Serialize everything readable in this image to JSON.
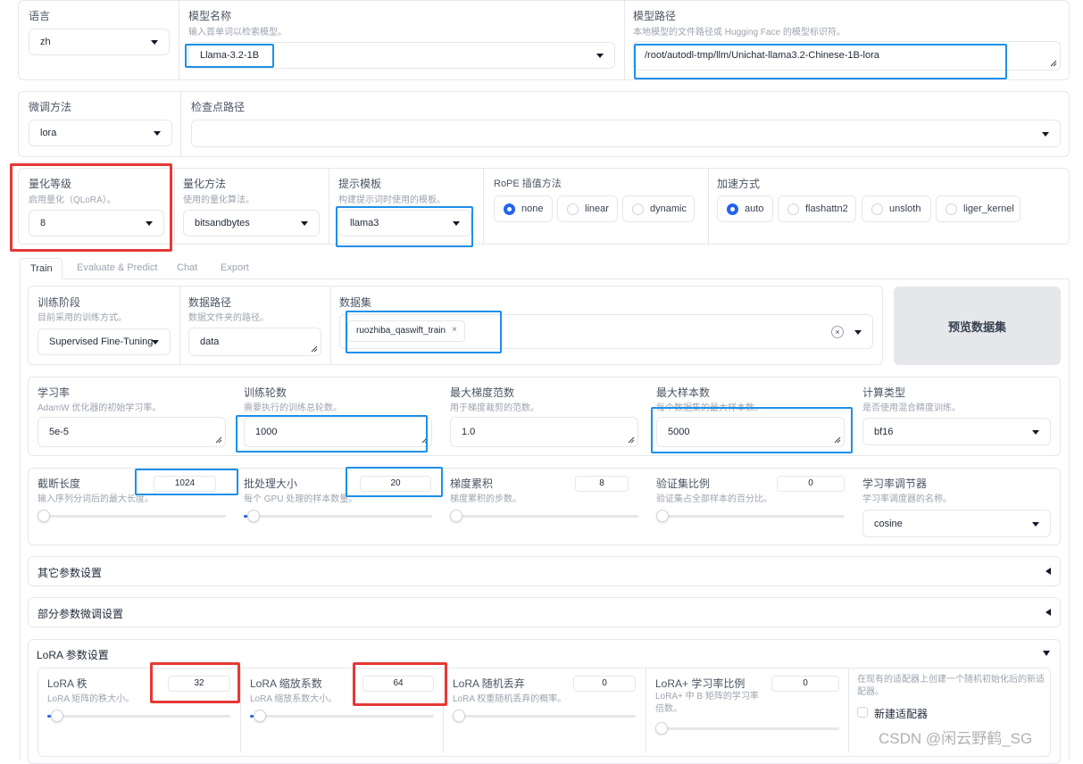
{
  "top": {
    "language": {
      "label": "语言",
      "value": "zh"
    },
    "model_name": {
      "label": "模型名称",
      "sub": "输入首单词以检索模型。",
      "value": "Llama-3.2-1B"
    },
    "model_path": {
      "label": "模型路径",
      "sub": "本地模型的文件路径或 Hugging Face 的模型标识符。",
      "value": "/root/autodl-tmp/llm/Unichat-llama3.2-Chinese-1B-lora"
    }
  },
  "row2": {
    "finetune": {
      "label": "微调方法",
      "value": "lora"
    },
    "checkpoint": {
      "label": "检查点路径",
      "value": ""
    }
  },
  "row3": {
    "quant_level": {
      "label": "量化等级",
      "sub": "启用量化（QLoRA）。",
      "value": "8"
    },
    "quant_method": {
      "label": "量化方法",
      "sub": "使用的量化算法。",
      "value": "bitsandbytes"
    },
    "template": {
      "label": "提示模板",
      "sub": "构建提示词时使用的模板。",
      "value": "llama3"
    },
    "rope": {
      "label": "RoPE 插值方法",
      "options": [
        "none",
        "linear",
        "dynamic"
      ],
      "selected": "none"
    },
    "boost": {
      "label": "加速方式",
      "options": [
        "auto",
        "flashattn2",
        "unsloth",
        "liger_kernel"
      ],
      "selected": "auto"
    }
  },
  "tabs": [
    "Train",
    "Evaluate & Predict",
    "Chat",
    "Export"
  ],
  "train": {
    "stage": {
      "label": "训练阶段",
      "sub": "目前采用的训练方式。",
      "value": "Supervised Fine-Tuning"
    },
    "dataset_dir": {
      "label": "数据路径",
      "sub": "数据文件夹的路径。",
      "value": "data"
    },
    "dataset": {
      "label": "数据集",
      "chip": "ruozhiba_qaswift_train",
      "chip_close": "×",
      "clear": "×"
    },
    "preview_button": "预览数据集",
    "lr": {
      "label": "学习率",
      "sub": "AdamW 优化器的初始学习率。",
      "value": "5e-5"
    },
    "epochs": {
      "label": "训练轮数",
      "sub": "需要执行的训练总轮数。",
      "value": "1000"
    },
    "max_grad": {
      "label": "最大梯度范数",
      "sub": "用于梯度裁剪的范数。",
      "value": "1.0"
    },
    "max_samples": {
      "label": "最大样本数",
      "sub": "每个数据集的最大样本数。",
      "value": "5000"
    },
    "compute_type": {
      "label": "计算类型",
      "sub": "是否使用混合精度训练。",
      "value": "bf16"
    },
    "cutoff": {
      "label": "截断长度",
      "sub": "输入序列分词后的最大长度。",
      "value": "1024",
      "fraction": 0.0
    },
    "batch": {
      "label": "批处理大小",
      "sub": "每个 GPU 处理的样本数量。",
      "value": "20",
      "fraction": 0.02
    },
    "grad_accum": {
      "label": "梯度累积",
      "sub": "梯度累积的步数。",
      "value": "8",
      "fraction": 0.0
    },
    "val_size": {
      "label": "验证集比例",
      "sub": "验证集占全部样本的百分比。",
      "value": "0",
      "fraction": 0.0
    },
    "scheduler": {
      "label": "学习率调节器",
      "sub": "学习率调度器的名称。",
      "value": "cosine"
    },
    "acc_other": "其它参数设置",
    "acc_partial": "部分参数微调设置",
    "acc_lora": "LoRA 参数设置",
    "lora": {
      "rank": {
        "label": "LoRA 秩",
        "sub": "LoRA 矩阵的秩大小。",
        "value": "32",
        "fraction": 0.02
      },
      "alpha": {
        "label": "LoRA 缩放系数",
        "sub": "LoRA 缩放系数大小。",
        "value": "64",
        "fraction": 0.02
      },
      "dropout": {
        "label": "LoRA 随机丢弃",
        "sub": "LoRA 权重随机丢弃的概率。",
        "value": "0",
        "fraction": 0.0
      },
      "plus": {
        "label": "LoRA+ 学习率比例",
        "sub": "LoRA+ 中 B 矩阵的学习率倍数。",
        "value": "0",
        "fraction": 0.0
      },
      "new_adapter_desc": "在现有的适配器上创建一个随机初始化后的新适配器。",
      "new_adapter_label": "新建适配器"
    }
  },
  "watermark": "CSDN @闲云野鹤_SG",
  "colors": {
    "accent": "#2563eb",
    "highlight_blue": "#1d8fe8",
    "highlight_red": "#e53935"
  }
}
